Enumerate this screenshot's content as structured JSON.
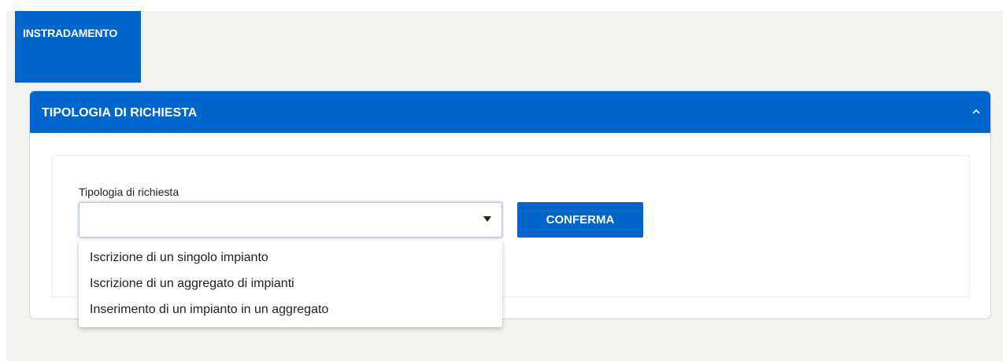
{
  "tab": {
    "label": "INSTRADAMENTO"
  },
  "section": {
    "title": "TIPOLOGIA DI RICHIESTA",
    "collapse_icon": "chevron-up-icon"
  },
  "form": {
    "field_label": "Tipologia di richiesta",
    "select_value": "",
    "confirm_label": "CONFERMA",
    "options": [
      "Iscrizione di un singolo impianto",
      "Iscrizione di un aggregato di impianti",
      "Inserimento di un impianto in un aggregato"
    ]
  },
  "colors": {
    "primary": "#0066cc",
    "background": "#f2f2ee",
    "text": "#222222"
  }
}
